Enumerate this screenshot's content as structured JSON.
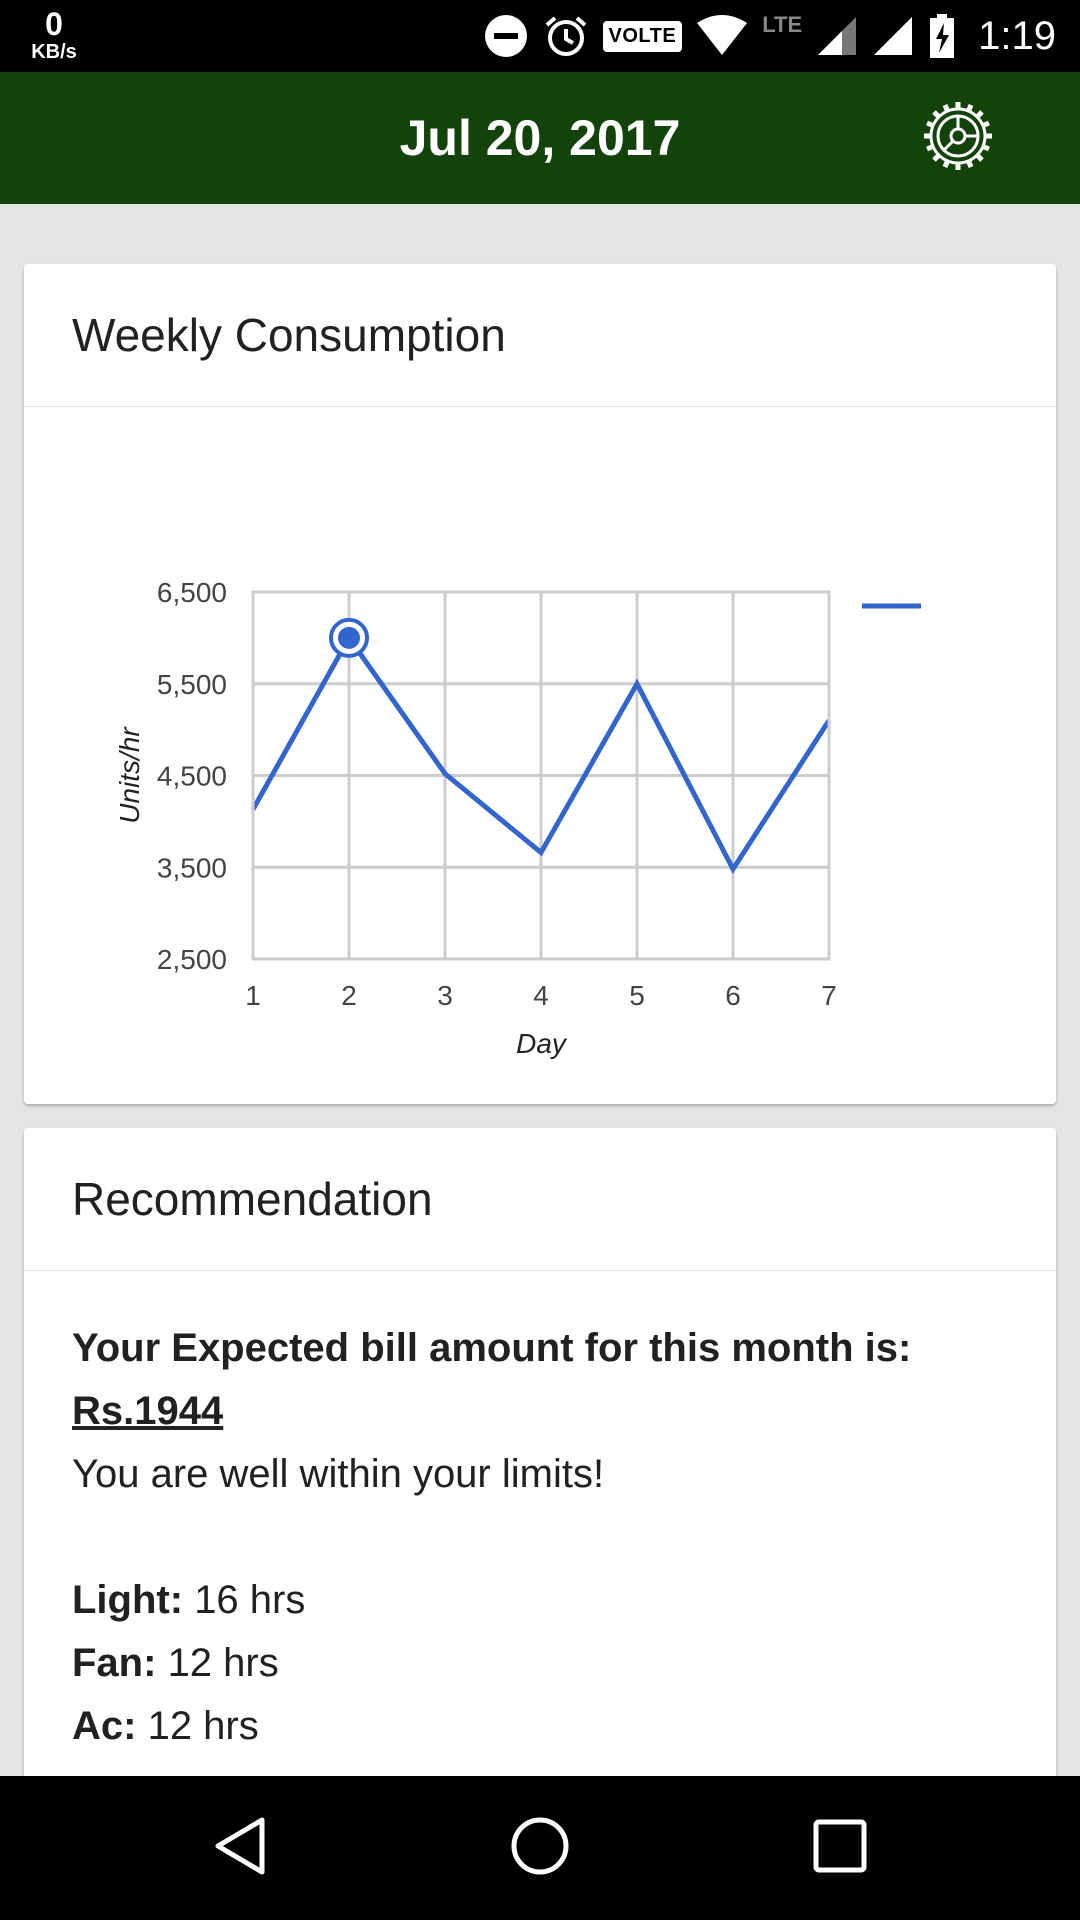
{
  "status_bar": {
    "net_speed_value": "0",
    "net_speed_unit": "KB/s",
    "network_type": "LTE",
    "volte_label": "VOLTE",
    "time": "1:19"
  },
  "app_bar": {
    "title": "Jul 20, 2017"
  },
  "chart_card": {
    "title": "Weekly Consumption"
  },
  "chart_data": {
    "type": "line",
    "x": [
      1,
      2,
      3,
      4,
      5,
      6,
      7
    ],
    "series": [
      {
        "values": [
          4130,
          6000,
          4520,
          3660,
          5500,
          3480,
          5100
        ],
        "color": "#3366cc"
      }
    ],
    "xlabel": "Day",
    "ylabel": "Units/hr",
    "ylim": [
      2500,
      6500
    ],
    "yticks": [
      "2,500",
      "3,500",
      "4,500",
      "5,500",
      "6,500"
    ],
    "xticks": [
      "1",
      "2",
      "3",
      "4",
      "5",
      "6",
      "7"
    ],
    "highlighted_x": 2,
    "grid": true,
    "legend_placement": "right"
  },
  "recommendation_card": {
    "title": "Recommendation",
    "expected_bill_label": "Your Expected bill amount for this month is:",
    "amount": "Rs.1944",
    "status_message": "You are well within your limits!",
    "appliances": [
      {
        "name": "Light:",
        "hours": "16 hrs"
      },
      {
        "name": "Fan:",
        "hours": "12 hrs"
      },
      {
        "name": "Ac:",
        "hours": "12 hrs"
      }
    ]
  }
}
